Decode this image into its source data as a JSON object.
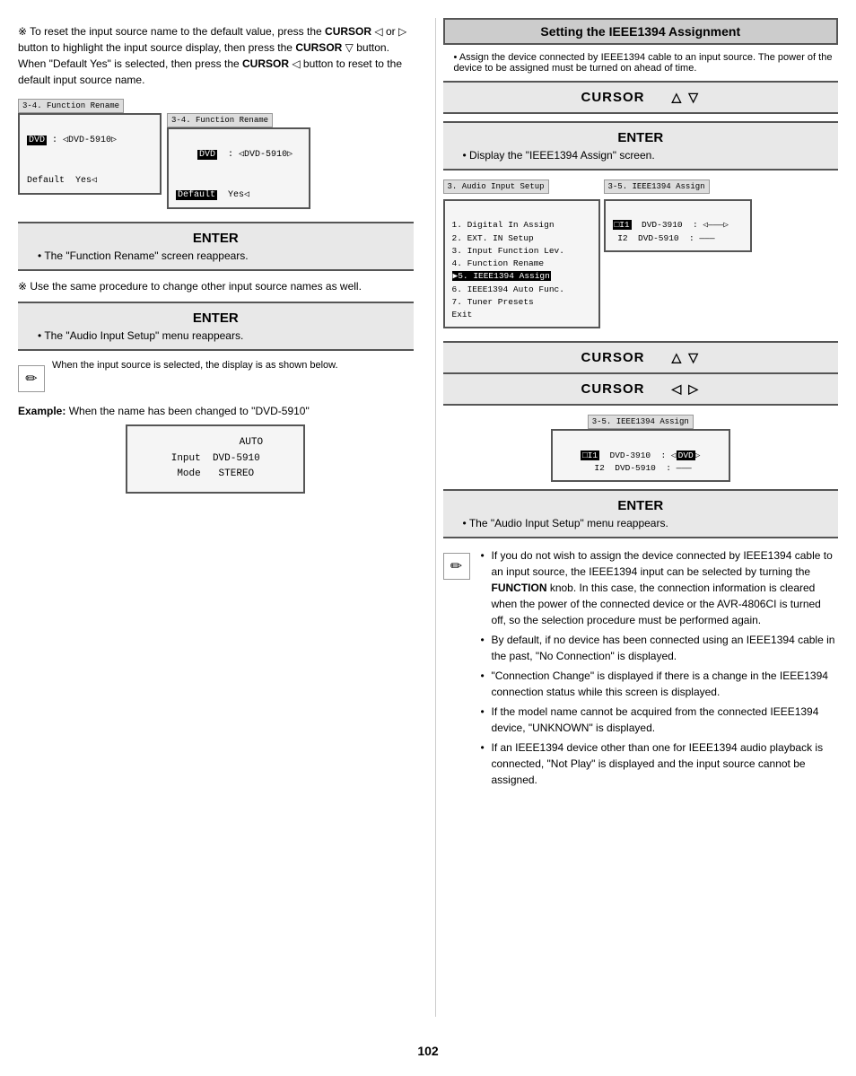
{
  "page": {
    "number": "102",
    "columns": {
      "left": {
        "note1": "To reset the input source name to the default value, press the CURSOR ◁ or ▷ button to highlight the input source display, then press the CURSOR ▽ button. When \"Default Yes\" is selected, then press the CURSOR ◁ button to reset to the default input source name.",
        "screen1_label": "3-4. Function Rename",
        "screen1_line1": "□DVD : ◁DVD-5910▷",
        "screen1_line2": "",
        "screen1_line3": "Default  Yes◁",
        "screen2_label": "3-4. Function Rename",
        "screen2_line1": "    DVD  : ◁DVD-5910▷",
        "screen2_line2": "",
        "screen2_line3": "□Default  Yes◁",
        "enter1_title": "ENTER",
        "enter1_desc": "• The \"Function Rename\" screen reappears.",
        "note2": "Use the same procedure to change other input source names as well.",
        "enter2_title": "ENTER",
        "enter2_desc": "• The \"Audio Input Setup\" menu reappears.",
        "pencil_note": "When the input source is selected, the display is as shown below.",
        "example_label": "Example:",
        "example_desc": "When the name has been changed to \"DVD-5910\"",
        "example_screen_line1": "            AUTO",
        "example_screen_line2": "Input  DVD-5910",
        "example_screen_line3": "Mode   STEREO"
      },
      "right": {
        "section_title": "Setting the IEEE1394 Assignment",
        "intro": "Assign the device connected by IEEE1394 cable to an input source. The power of the device to be assigned must be turned on ahead of time.",
        "cursor1_label": "CURSOR",
        "cursor1_arrows": "△    ▽",
        "enter1_title": "ENTER",
        "enter1_desc": "• Display the \"IEEE1394 Assign\" screen.",
        "menu_screen_label": "3. Audio Input Setup",
        "menu_lines": [
          "1. Digital In Assign",
          "2. EXT. IN Setup",
          "3. Input Function Lev.",
          "4. Function Rename",
          "▶5. IEEE1394 Assign",
          "6. IEEE1394 Auto Func.",
          "7. Tuner Presets",
          "Exit"
        ],
        "assign_screen_label": "3-5. IEEE1394 Assign",
        "assign_lines": [
          "□I1   DVD-3910   : ◁———▷",
          " I2   DVD-5910   : ———"
        ],
        "cursor2_label": "CURSOR",
        "cursor2_arrows": "△    ▽",
        "cursor3_label": "CURSOR",
        "cursor3_arrows": "◁    ▷",
        "assign2_screen_label": "3-5. IEEE1394 Assign",
        "assign2_lines": [
          "□I1   DVD-3910   : ◁DVD▷",
          " I2   DVD-5910   : ———"
        ],
        "enter2_title": "ENTER",
        "enter2_desc": "• The \"Audio Input Setup\" menu reappears.",
        "notes": [
          "If you do not wish to assign the device connected by IEEE1394 cable to an input source, the IEEE1394 input can be selected by turning the FUNCTION knob. In this case, the connection information is cleared when the power of the connected device or the AVR-4806CI is turned off, so the selection procedure must be performed again.",
          "By default, if no device has been connected using an IEEE1394 cable in the past, \"No Connection\" is displayed.",
          "\"Connection Change\" is displayed if there is a change in the IEEE1394 connection status while this screen is displayed.",
          "If the model name cannot be acquired from the connected IEEE1394 device, \"UNKNOWN\" is displayed.",
          "If an IEEE1394 device other than one for IEEE1394 audio playback is connected, \"Not Play\" is displayed and the input source cannot be assigned."
        ]
      }
    }
  }
}
